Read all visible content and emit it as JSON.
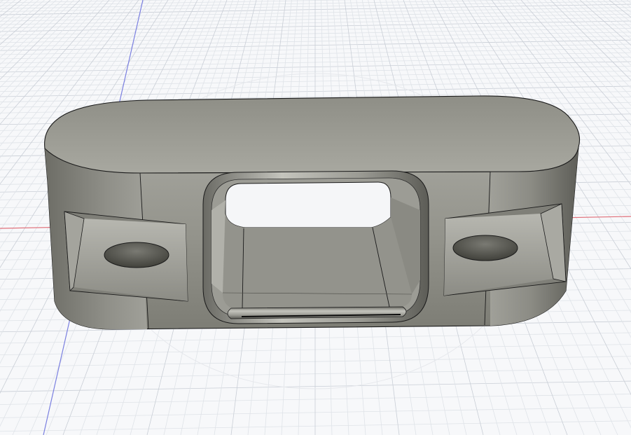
{
  "viewport": {
    "background": "#f7f8fa",
    "grid_minor_color": "#dfe3e8",
    "grid_major_color": "#c9ced6",
    "axis_x_color": "#e0707a",
    "axis_z_color": "#7a7fe0"
  },
  "model": {
    "body_color": "#8f8f87",
    "top_color": "#a3a39c",
    "edge_color": "#1a1a1a",
    "through_slot": "rounded-rectangle",
    "mounting_holes": 2
  }
}
